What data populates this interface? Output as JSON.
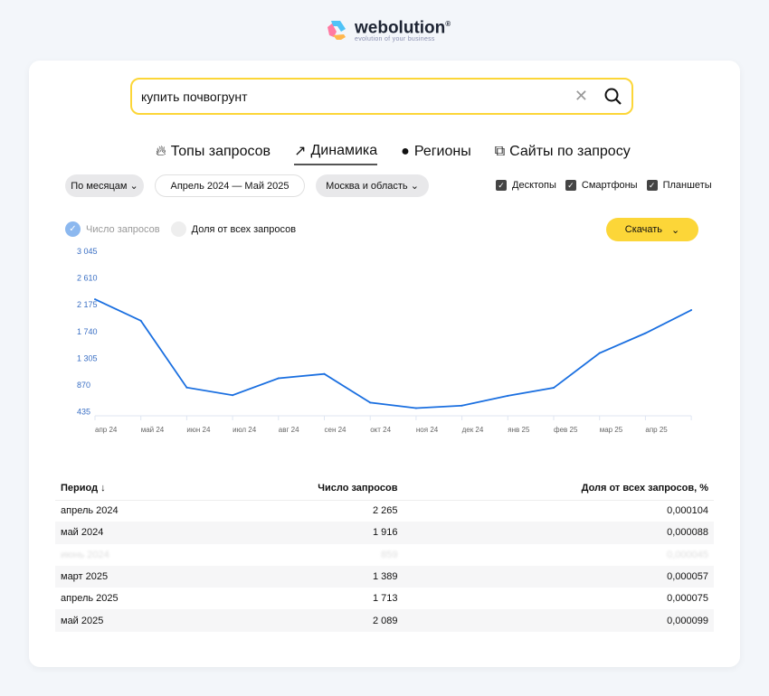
{
  "logo": {
    "name": "webolution",
    "tagline": "evolution of your business"
  },
  "search": {
    "value": "купить почвогрунт"
  },
  "tabs": [
    {
      "label": "Топы запросов",
      "icon": "fire-icon"
    },
    {
      "label": "Динамика",
      "icon": "trend-icon",
      "active": true
    },
    {
      "label": "Регионы",
      "icon": "globe-icon"
    },
    {
      "label": "Сайты по запросу",
      "icon": "external-link-icon"
    }
  ],
  "filters": {
    "period": "По месяцам",
    "range": "Апрель 2024 — Май 2025",
    "region": "Москва и область"
  },
  "devices": [
    "Десктопы",
    "Смартфоны",
    "Планшеты"
  ],
  "legend": {
    "count": "Число запросов",
    "share": "Доля от всех запросов"
  },
  "download": "Скачать",
  "colors": {
    "accent": "#fcd638",
    "line": "#1a6fe0"
  },
  "chart_data": {
    "type": "line",
    "categories": [
      "апр 24",
      "май 24",
      "июн 24",
      "июл 24",
      "авг 24",
      "сен 24",
      "окт 24",
      "ноя 24",
      "дек 24",
      "янв 25",
      "фев 25",
      "мар 25",
      "апр 25",
      ""
    ],
    "values": [
      2265,
      1916,
      830,
      705,
      980,
      1050,
      585,
      495,
      535,
      695,
      825,
      1389,
      1713,
      2089
    ],
    "yticks": [
      "435",
      "870",
      "1 305",
      "1 740",
      "2 175",
      "2 610",
      "3 045"
    ],
    "ytick_values": [
      435,
      870,
      1305,
      1740,
      2175,
      2610,
      3045
    ],
    "ylim": [
      370,
      3045
    ],
    "grid": false
  },
  "table": {
    "headers": [
      "Период ↓",
      "Число запросов",
      "Доля от всех запросов, %"
    ],
    "rows": [
      [
        "апрель 2024",
        "2 265",
        "0,000104"
      ],
      [
        "май 2024",
        "1 916",
        "0,000088"
      ],
      [
        "июнь 2024",
        "859",
        "0,000045"
      ],
      [
        "март 2025",
        "1 389",
        "0,000057"
      ],
      [
        "апрель 2025",
        "1 713",
        "0,000075"
      ],
      [
        "май 2025",
        "2 089",
        "0,000099"
      ]
    ]
  }
}
